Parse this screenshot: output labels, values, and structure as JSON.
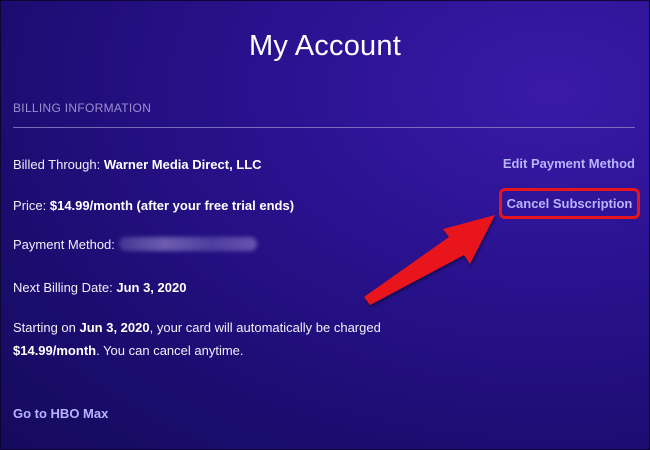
{
  "page": {
    "title": "My Account"
  },
  "billing": {
    "heading": "BILLING INFORMATION",
    "billed_through_label": "Billed Through:",
    "billed_through_value": "Warner Media Direct, LLC",
    "price_label": "Price:",
    "price_value": "$14.99/month (after your free trial ends)",
    "payment_method_label": "Payment Method:",
    "next_billing_label": "Next Billing Date:",
    "next_billing_value": "Jun 3, 2020",
    "notice_prefix": "Starting on",
    "notice_date": "Jun 3, 2020",
    "notice_middle": ", your card will automatically be charged",
    "notice_amount": "$14.99/month",
    "notice_suffix": ". You can cancel anytime."
  },
  "actions": {
    "edit_payment": "Edit Payment Method",
    "cancel_subscription": "Cancel Subscription",
    "go_to_hbo": "Go to HBO Max"
  },
  "colors": {
    "background": "#1b0c6e",
    "link": "#b9b4ff",
    "highlight_box": "#e8141b",
    "arrow": "#e8141b"
  },
  "annotations": {
    "arrow_icon": "red-arrow-icon",
    "highlight": "cancel-subscription-highlight-box"
  }
}
